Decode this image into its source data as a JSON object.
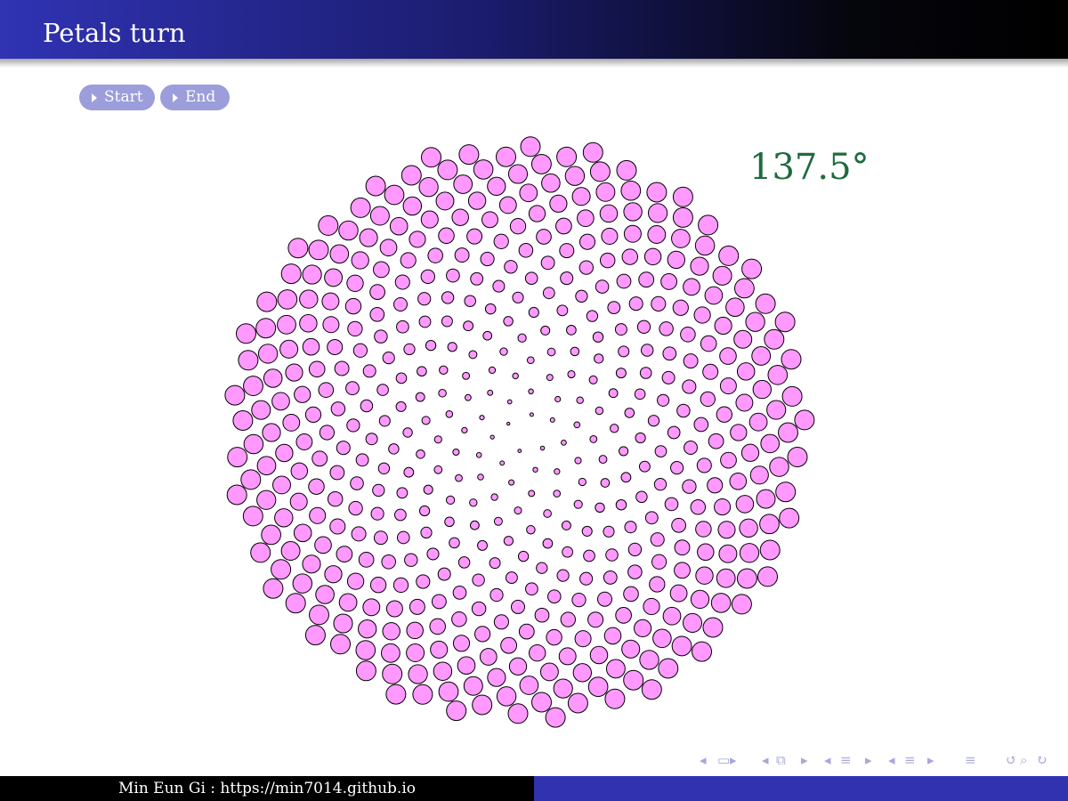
{
  "frame": {
    "title": "Petals turn"
  },
  "nav_buttons": {
    "start_label": "Start",
    "end_label": "End"
  },
  "figure": {
    "angle_label": "137.5°",
    "divergence_angle_deg": 137.5,
    "petal_count": 500,
    "petal_fill": "#ff99ff",
    "petal_stroke": "#000000",
    "center_fill": "#ffffff"
  },
  "footer": {
    "author_url": "Min Eun Gi : https://min7014.github.io"
  },
  "colors": {
    "title_text": "#ffffff",
    "button_bg": "#9c9ddb",
    "angle_text": "#1e6b3f",
    "footer_right_bg": "#3132b0"
  }
}
